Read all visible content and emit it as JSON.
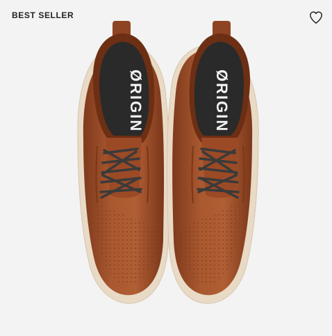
{
  "badge": {
    "label": "BEST SELLER"
  },
  "wishlist": {
    "icon": "heart-outline-icon"
  },
  "product": {
    "insole_brand": "ØRIGIN",
    "colors": {
      "leather": "#a3512b",
      "sole": "#e9dac6",
      "laces": "#3a3a3a",
      "insole": "#2a2a2a"
    }
  }
}
